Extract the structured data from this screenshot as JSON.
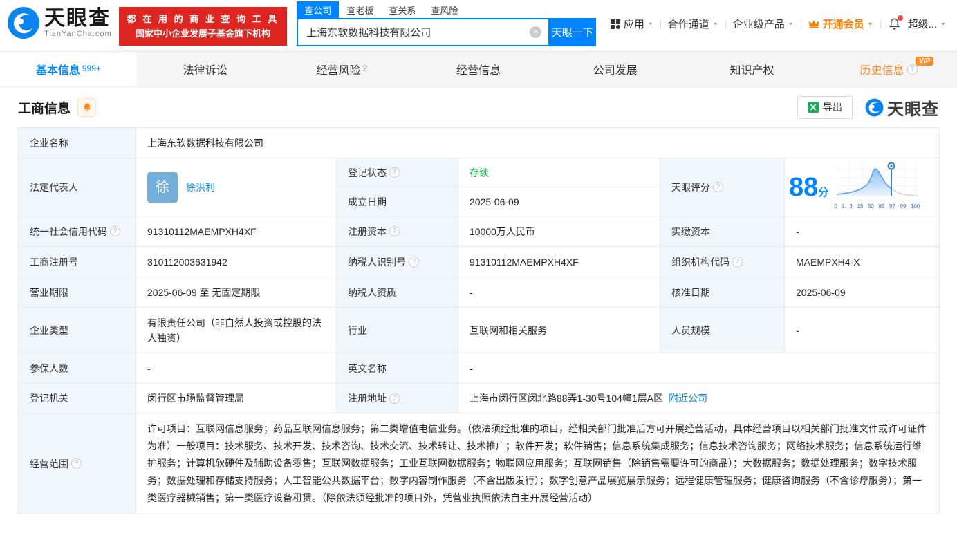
{
  "glyphs": {
    "help": "?",
    "caret": "▼",
    "clear": "×"
  },
  "colors": {
    "accent": "#0084ff",
    "status_green": "#00b038",
    "vip_orange": "#ff8c26",
    "banner_red": "#dd2621"
  },
  "header": {
    "brand": "天眼查",
    "brand_domain": "TianYanCha.com",
    "slogan_line1": "都 在 用 的 商 业 查 询 工 具",
    "slogan_line2": "国家中小企业发展子基金旗下机构",
    "search": {
      "tabs": [
        {
          "label": "查公司"
        },
        {
          "label": "查老板"
        },
        {
          "label": "查关系"
        },
        {
          "label": "查风险"
        }
      ],
      "value": "上海东软数据科技有限公司",
      "button_label": "天眼一下"
    },
    "nav": {
      "apps": "应用",
      "partner": "合作通道",
      "enterprise": "企业级产品",
      "vip": "开通会员",
      "account": "超级..."
    }
  },
  "tabs": [
    {
      "label": "基本信息",
      "badge": "999+"
    },
    {
      "label": "法律诉讼"
    },
    {
      "label": "经营风险",
      "badge": "2"
    },
    {
      "label": "经营信息"
    },
    {
      "label": "公司发展"
    },
    {
      "label": "知识产权"
    },
    {
      "label": "历史信息",
      "badge": "VIP"
    }
  ],
  "section": {
    "title": "工商信息",
    "export_label": "导出",
    "watermark_brand": "天眼查"
  },
  "company": {
    "name_label": "企业名称",
    "name": "上海东软数据科技有限公司",
    "legal_rep_label": "法定代表人",
    "legal_rep_avatar": "徐",
    "legal_rep_name": "徐洪利",
    "reg_status_label": "登记状态",
    "reg_status": "存续",
    "establish_date_label": "成立日期",
    "establish_date": "2025-06-09",
    "score_label": "天眼评分",
    "score_value": "88",
    "score_unit": "分",
    "credit_code_label": "统一社会信用代码",
    "credit_code": "91310112MAEMPXH4XF",
    "reg_capital_label": "注册资本",
    "reg_capital": "10000万人民币",
    "paid_capital_label": "实缴资本",
    "paid_capital": "-",
    "reg_number_label": "工商注册号",
    "reg_number": "310112003631942",
    "taxpayer_id_label": "纳税人识别号",
    "taxpayer_id": "91310112MAEMPXH4XF",
    "org_code_label": "组织机构代码",
    "org_code": "MAEMPXH4-X",
    "business_term_label": "营业期限",
    "business_term": "2025-06-09 至 无固定期限",
    "taxpayer_quality_label": "纳税人资质",
    "taxpayer_quality": "-",
    "approval_date_label": "核准日期",
    "approval_date": "2025-06-09",
    "company_type_label": "企业类型",
    "company_type": "有限责任公司（非自然人投资或控股的法人独资）",
    "industry_label": "行业",
    "industry": "互联网和相关服务",
    "staff_size_label": "人员规模",
    "staff_size": "-",
    "insured_count_label": "参保人数",
    "insured_count": "-",
    "english_name_label": "英文名称",
    "english_name": "-",
    "reg_authority_label": "登记机关",
    "reg_authority": "闵行区市场监督管理局",
    "reg_address_label": "注册地址",
    "reg_address": "上海市闵行区闵北路88弄1-30号104幢1层A区",
    "nearby_link": "附近公司",
    "business_scope_label": "经营范围",
    "business_scope": "许可项目：互联网信息服务；药品互联网信息服务；第二类增值电信业务。（依法须经批准的项目，经相关部门批准后方可开展经营活动，具体经营项目以相关部门批准文件或许可证件为准）一般项目：技术服务、技术开发、技术咨询、技术交流、技术转让、技术推广；软件开发；软件销售；信息系统集成服务；信息技术咨询服务；网络技术服务；信息系统运行维护服务；计算机软硬件及辅助设备零售；互联网数据服务；工业互联网数据服务；物联网应用服务；互联网销售（除销售需要许可的商品）；大数据服务；数据处理服务；数字技术服务；数据处理和存储支持服务；人工智能公共数据平台；数字内容制作服务（不含出版发行）；数字创意产品展览展示服务；远程健康管理服务；健康咨询服务（不含诊疗服务）；第一类医疗器械销售；第一类医疗设备租赁。（除依法须经批准的项目外，凭营业执照依法自主开展经营活动）"
  },
  "score_chart": {
    "type": "area",
    "x_ticks": [
      "0",
      "1",
      "3",
      "15",
      "50",
      "85",
      "97",
      "99",
      "100"
    ],
    "marker_value": 88,
    "curve_color": "#5b9df9",
    "marker_color": "#2b7de1"
  }
}
